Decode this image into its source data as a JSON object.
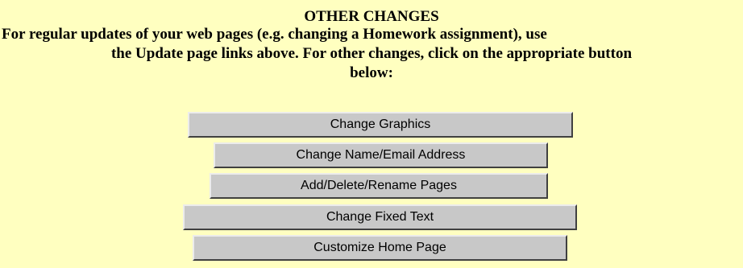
{
  "section": {
    "title": "OTHER CHANGES",
    "intro_lines": [
      "For regular updates of your web pages (e.g. changing a Homework assignment), use",
      "the Update page links above. For other changes, click on the appropriate button",
      "below:"
    ]
  },
  "buttons": [
    {
      "label": "Change Graphics"
    },
    {
      "label": "Change Name/Email Address"
    },
    {
      "label": "Add/Delete/Rename Pages"
    },
    {
      "label": "Change Fixed Text"
    },
    {
      "label": "Customize Home Page"
    }
  ],
  "colors": {
    "background": "#ffffc0",
    "button_face": "#c8c8c8"
  }
}
